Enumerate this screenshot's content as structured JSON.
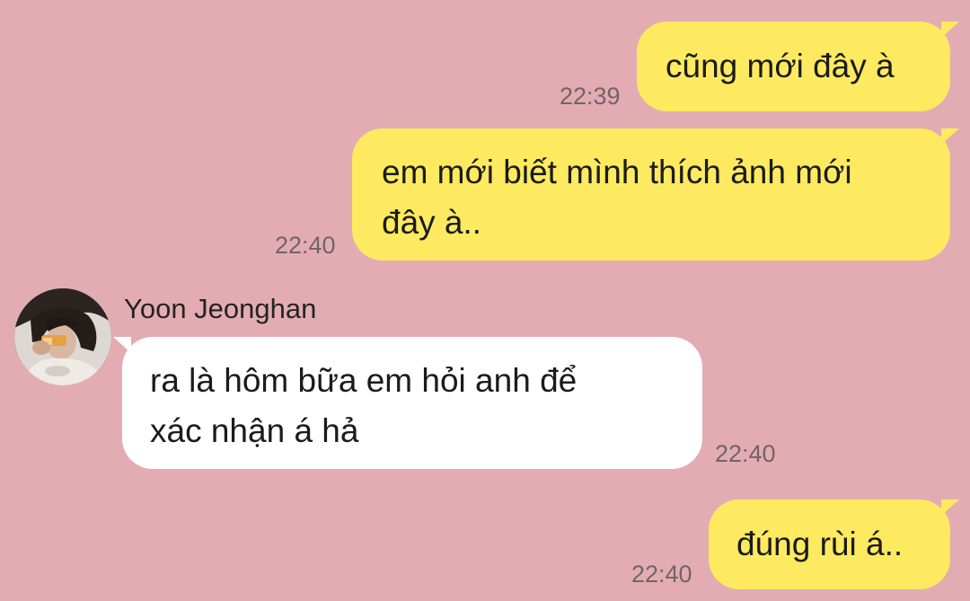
{
  "colors": {
    "background": "#e3acb3",
    "outgoing_bubble": "#fdea60",
    "incoming_bubble": "#ffffff",
    "timestamp": "#70646a"
  },
  "messages": [
    {
      "direction": "outgoing",
      "text": "cũng mới đây à",
      "time": "22:39"
    },
    {
      "direction": "outgoing",
      "text_lines": [
        "em mới biết mình thích ảnh mới",
        "đây à.."
      ],
      "time": "22:40"
    },
    {
      "direction": "incoming",
      "sender": "Yoon Jeonghan",
      "avatar_icon": "profile-photo",
      "text_lines": [
        "ra là hôm bữa em hỏi anh để",
        "xác nhận á hả"
      ],
      "time": "22:40"
    },
    {
      "direction": "outgoing",
      "text": "đúng rùi á..",
      "time": "22:40"
    }
  ]
}
